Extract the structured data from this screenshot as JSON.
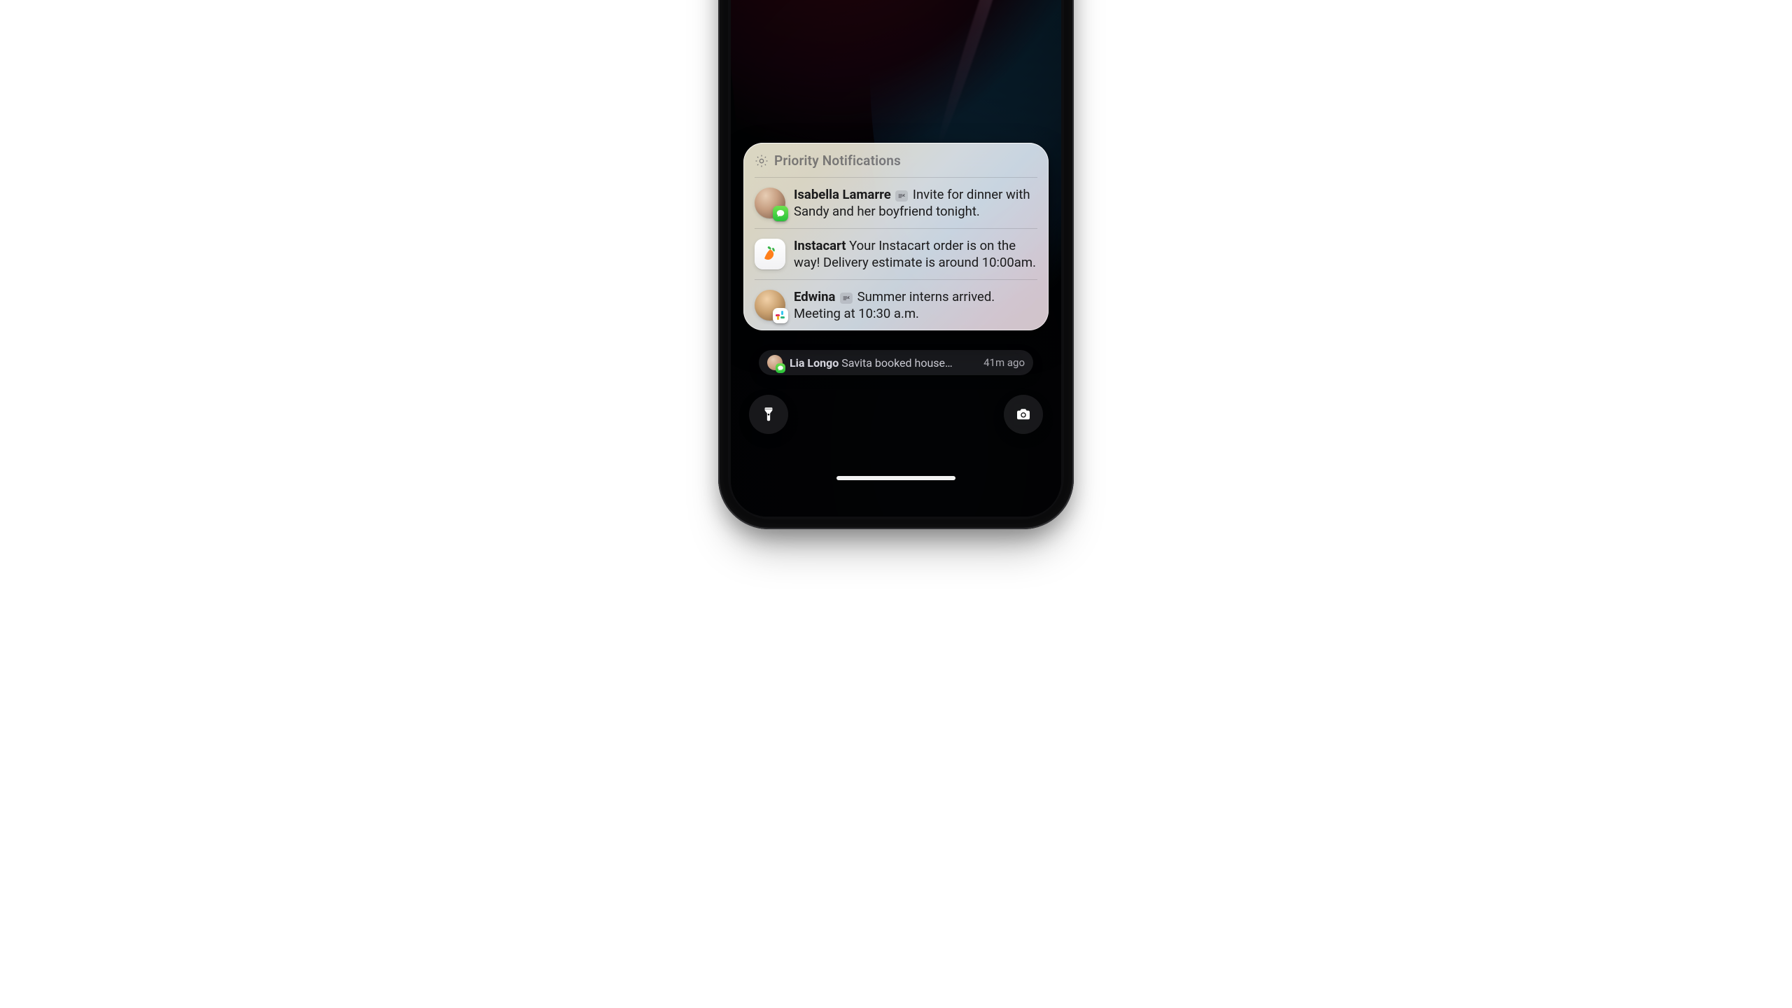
{
  "lockscreen": {
    "priority": {
      "title": "Priority Notifications",
      "items": [
        {
          "sender": "Isabella Lamarre",
          "message": "Invite for dinner with Sandy and her boyfriend tonight."
        },
        {
          "sender": "Instacart",
          "message": "Your Instacart order is on the way! Delivery estimate is around 10:00am."
        },
        {
          "sender": "Edwina",
          "message": "Summer interns arrived. Meeting at 10:30 a.m."
        }
      ]
    },
    "below": {
      "sender": "Lia Longo",
      "message": "Savita booked house…",
      "time": "41m ago"
    },
    "quick_actions": {
      "flashlight": "Flashlight",
      "camera": "Camera"
    }
  }
}
